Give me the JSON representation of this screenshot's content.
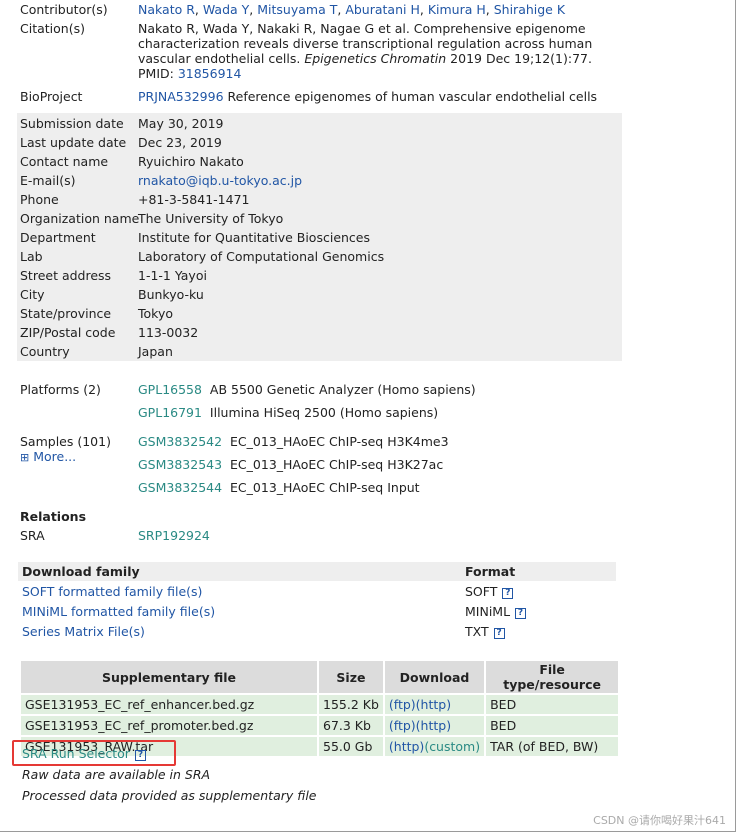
{
  "header": {
    "contributors_label": "Contributor(s)",
    "contributors": [
      "Nakato R",
      "Wada Y",
      "Mitsuyama T",
      "Aburatani H",
      "Kimura H",
      "Shirahige K"
    ],
    "citation_label": "Citation(s)",
    "citation_line1": "Nakato R, Wada Y, Nakaki R, Nagae G et al. Comprehensive epigenome",
    "citation_line2": "characterization reveals diverse transcriptional regulation across human",
    "citation_line3_pre": "vascular endothelial cells. ",
    "citation_journal": "Epigenetics Chromatin",
    "citation_line3_post": " 2019 Dec 19;12(1):77.",
    "pmid_label": "PMID: ",
    "pmid": "31856914",
    "bioproject_label": "BioProject",
    "bioproject_id": "PRJNA532996",
    "bioproject_desc": "Reference epigenomes of human vascular endothelial cells"
  },
  "contact": [
    {
      "label": "Submission date",
      "value": "May 30, 2019"
    },
    {
      "label": "Last update date",
      "value": "Dec 23, 2019"
    },
    {
      "label": "Contact name",
      "value": "Ryuichiro Nakato"
    },
    {
      "label": "E-mail(s)",
      "value": "rnakato@iqb.u-tokyo.ac.jp"
    },
    {
      "label": "Phone",
      "value": "+81-3-5841-1471"
    },
    {
      "label": "Organization name",
      "value": "The University of Tokyo"
    },
    {
      "label": "Department",
      "value": "Institute for Quantitative Biosciences"
    },
    {
      "label": "Lab",
      "value": "Laboratory of Computational Genomics"
    },
    {
      "label": "Street address",
      "value": "1-1-1 Yayoi"
    },
    {
      "label": "City",
      "value": "Bunkyo-ku"
    },
    {
      "label": "State/province",
      "value": "Tokyo"
    },
    {
      "label": "ZIP/Postal code",
      "value": "113-0032"
    },
    {
      "label": "Country",
      "value": "Japan"
    }
  ],
  "platforms": {
    "label": "Platforms (2)",
    "items": [
      {
        "id": "GPL16558",
        "desc": "AB 5500 Genetic Analyzer (Homo sapiens)"
      },
      {
        "id": "GPL16791",
        "desc": "Illumina HiSeq 2500 (Homo sapiens)"
      }
    ]
  },
  "samples": {
    "label": "Samples (101)",
    "more": "More...",
    "items": [
      {
        "id": "GSM3832542",
        "desc": "EC_013_HAoEC ChIP-seq H3K4me3"
      },
      {
        "id": "GSM3832543",
        "desc": "EC_013_HAoEC ChIP-seq H3K27ac"
      },
      {
        "id": "GSM3832544",
        "desc": "EC_013_HAoEC ChIP-seq Input"
      }
    ]
  },
  "relations": {
    "heading": "Relations",
    "sra_label": "SRA",
    "sra_id": "SRP192924"
  },
  "download_family": {
    "header_family": "Download family",
    "header_format": "Format",
    "rows": [
      {
        "name": "SOFT formatted family file(s)",
        "format": "SOFT"
      },
      {
        "name": "MINiML formatted family file(s)",
        "format": "MINiML"
      },
      {
        "name": "Series Matrix File(s)",
        "format": "TXT"
      }
    ]
  },
  "supplementary": {
    "headers": [
      "Supplementary file",
      "Size",
      "Download",
      "File type/resource"
    ],
    "rows": [
      {
        "file": "GSE131953_EC_ref_enhancer.bed.gz",
        "size": "155.2 Kb",
        "dl1": "(ftp)",
        "dl2": "(http)",
        "type": "BED"
      },
      {
        "file": "GSE131953_EC_ref_promoter.bed.gz",
        "size": "67.3 Kb",
        "dl1": "(ftp)",
        "dl2": "(http)",
        "type": "BED"
      },
      {
        "file": "GSE131953_RAW.tar",
        "size": "55.0 Gb",
        "dl1": "(http)",
        "dl2": "(custom)",
        "type": "TAR (of BED, BW)"
      }
    ],
    "sra_run_selector": "SRA Run Selector",
    "note1": "Raw data are available in SRA",
    "note2": "Processed data provided as supplementary file"
  },
  "watermark": "CSDN @请你喝好果汁641",
  "help_glyph": "?",
  "more_glyph": "⊞"
}
